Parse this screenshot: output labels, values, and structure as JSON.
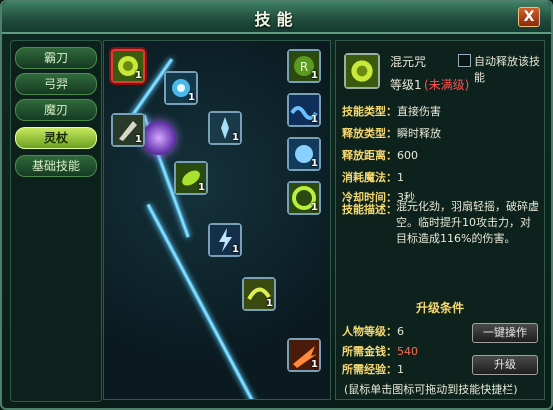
{
  "window": {
    "title": "技能",
    "close_label": "X"
  },
  "tabs": [
    {
      "label": "霸刀",
      "active": false
    },
    {
      "label": "弓羿",
      "active": false
    },
    {
      "label": "魔刃",
      "active": false
    },
    {
      "label": "灵杖",
      "active": true
    },
    {
      "label": "基础技能",
      "active": false
    }
  ],
  "skills": [
    {
      "level": "1",
      "selected": true
    },
    {
      "level": "1"
    },
    {
      "level": "1"
    },
    {
      "level": "1"
    },
    {
      "level": "1"
    },
    {
      "level": "1"
    },
    {
      "level": "1"
    },
    {
      "level": "1"
    },
    {
      "level": "1"
    },
    {
      "level": "1"
    },
    {
      "level": "1"
    },
    {
      "level": "1"
    },
    {
      "level": "1"
    }
  ],
  "detail": {
    "name": "混元咒",
    "auto_release_label": "自动释放该技能",
    "level_label": "等级1",
    "level_status": "(未满级)",
    "props": [
      {
        "key": "技能类型：",
        "value": "直接伤害"
      },
      {
        "key": "释放类型：",
        "value": "瞬时释放"
      },
      {
        "key": "释放距离：",
        "value": "600"
      },
      {
        "key": "消耗魔法：",
        "value": "1"
      },
      {
        "key": "冷却时间：",
        "value": "3秒"
      }
    ],
    "desc_key": "技能描述：",
    "desc_text": "混元化劲，羽扇轻摇，破碎虚空。临时提升10攻击力，对目标造成116%的伤害。"
  },
  "upgrade": {
    "title": "升级条件",
    "player_level_key": "人物等级：",
    "player_level_val": "6",
    "gold_key": "所需金钱：",
    "gold_val": "540",
    "exp_key": "所需经验：",
    "exp_val": "1",
    "one_key_button": "一键操作",
    "upgrade_button": "升级",
    "note": "(鼠标单击图标可拖动到技能快捷栏)"
  }
}
